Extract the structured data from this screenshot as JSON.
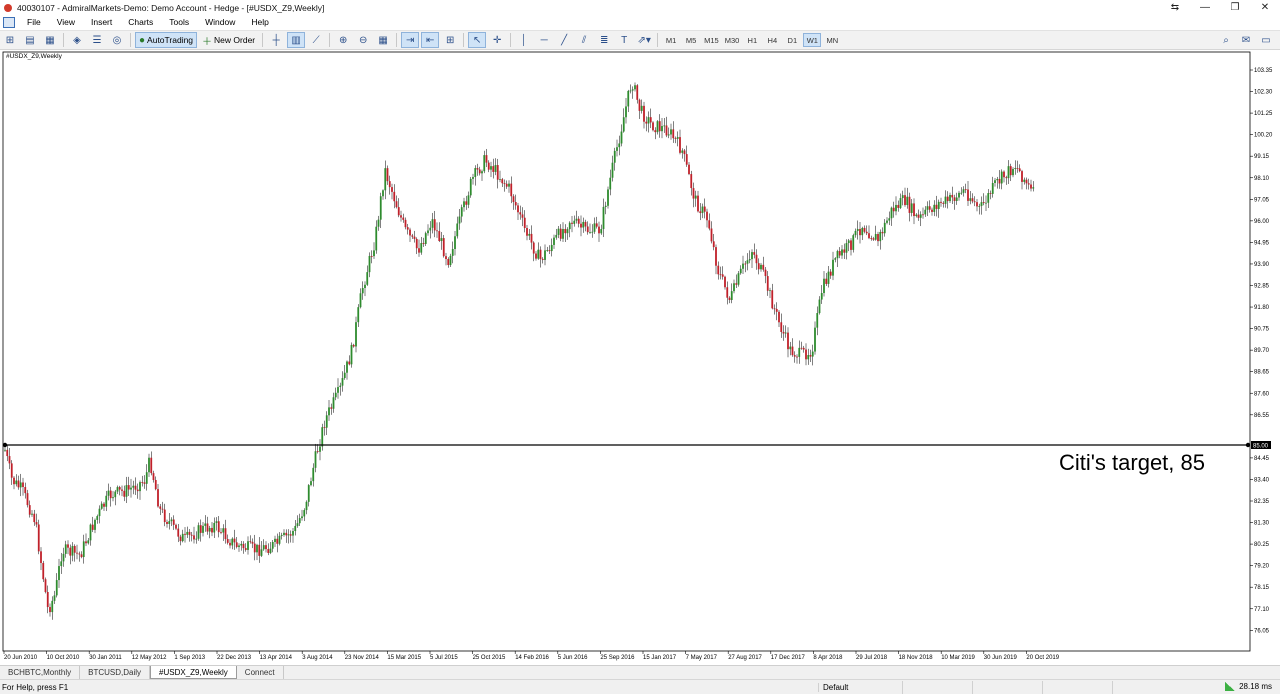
{
  "window": {
    "title": "40030107 - AdmiralMarkets-Demo: Demo Account - Hedge - [#USDX_Z9,Weekly]",
    "controls": [
      "⇆",
      "—",
      "❐",
      "✕"
    ]
  },
  "menu": [
    "File",
    "View",
    "Insert",
    "Charts",
    "Tools",
    "Window",
    "Help"
  ],
  "toolbar": {
    "autotrading_label": "AutoTrading",
    "new_order_label": "New Order",
    "timeframes": [
      "M1",
      "M5",
      "M15",
      "M30",
      "H1",
      "H4",
      "D1",
      "W1",
      "MN"
    ],
    "active_timeframe": "W1"
  },
  "chart": {
    "symbol_label": "#USDX_Z9,Weekly",
    "annotation": "Citi's target, 85",
    "hline_price_tag": "85.00",
    "bull_color": "#2e8b2e",
    "bear_color": "#c0202a",
    "price_axis_labels": [
      "103.35",
      "102.30",
      "101.25",
      "100.20",
      "99.15",
      "98.10",
      "97.05",
      "96.00",
      "94.95",
      "93.90",
      "92.85",
      "91.80",
      "90.75",
      "89.70",
      "88.65",
      "87.60",
      "86.55",
      "84.45",
      "83.40",
      "82.35",
      "81.30",
      "80.25",
      "79.20",
      "78.15",
      "77.10",
      "76.05"
    ],
    "date_axis_labels": [
      "20 Jun 2010",
      "10 Oct 2010",
      "30 Jan 2011",
      "12 May 2012",
      "1 Sep 2013",
      "22 Dec 2013",
      "13 Apr 2014",
      "3 Aug 2014",
      "23 Nov 2014",
      "15 Mar 2015",
      "5 Jul 2015",
      "25 Oct 2015",
      "14 Feb 2016",
      "5 Jun 2016",
      "25 Sep 2016",
      "15 Jan 2017",
      "7 May 2017",
      "27 Aug 2017",
      "17 Dec 2017",
      "8 Apr 2018",
      "29 Jul 2018",
      "18 Nov 2018",
      "10 Mar 2019",
      "30 Jun 2019",
      "20 Oct 2019"
    ]
  },
  "tabs": [
    "BCHBTC,Monthly",
    "BTCUSD,Daily",
    "#USDX_Z9,Weekly",
    "Connect"
  ],
  "active_tab": "#USDX_Z9,Weekly",
  "status": {
    "help": "For Help, press F1",
    "profile": "Default",
    "ping": "28.18 ms"
  }
}
